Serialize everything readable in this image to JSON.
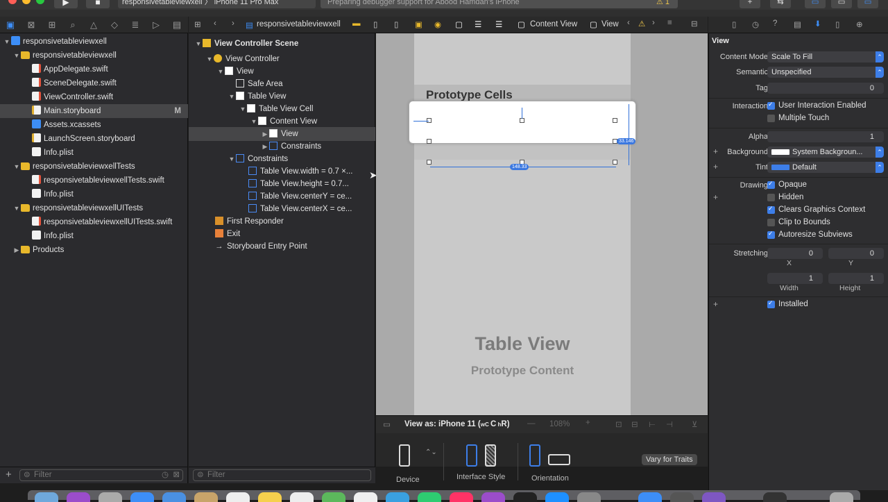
{
  "titlebar": {
    "scheme_project": "responsivetableviewxell",
    "scheme_device": "iPhone 11 Pro Max",
    "activity": "Preparing debugger support for Abood Hamdan's iPhone",
    "warning_count": "1"
  },
  "navigator": {
    "items": [
      {
        "label": "responsivetableviewxell",
        "icon": "project-icon"
      },
      {
        "label": "responsivetableviewxell",
        "icon": "folder-icon"
      },
      {
        "label": "AppDelegate.swift",
        "icon": "swift-file-icon"
      },
      {
        "label": "SceneDelegate.swift",
        "icon": "swift-file-icon"
      },
      {
        "label": "ViewController.swift",
        "icon": "swift-file-icon"
      },
      {
        "label": "Main.storyboard",
        "icon": "storyboard-icon",
        "badge": "M"
      },
      {
        "label": "Assets.xcassets",
        "icon": "asset-catalog-icon"
      },
      {
        "label": "LaunchScreen.storyboard",
        "icon": "storyboard-icon"
      },
      {
        "label": "Info.plist",
        "icon": "plist-icon"
      },
      {
        "label": "responsivetableviewxellTests",
        "icon": "folder-icon"
      },
      {
        "label": "responsivetableviewxellTests.swift",
        "icon": "swift-file-icon"
      },
      {
        "label": "Info.plist",
        "icon": "plist-icon"
      },
      {
        "label": "responsivetableviewxellUITests",
        "icon": "folder-icon"
      },
      {
        "label": "responsivetableviewxellUITests.swift",
        "icon": "swift-file-icon"
      },
      {
        "label": "Info.plist",
        "icon": "plist-icon"
      },
      {
        "label": "Products",
        "icon": "folder-icon"
      }
    ],
    "filter_placeholder": "Filter"
  },
  "jumpbar": {
    "project": "responsivetableviewxell",
    "content_view": "Content View",
    "view": "View"
  },
  "outline": {
    "items": [
      {
        "label": "View Controller Scene"
      },
      {
        "label": "View Controller"
      },
      {
        "label": "View"
      },
      {
        "label": "Safe Area"
      },
      {
        "label": "Table View"
      },
      {
        "label": "Table View Cell"
      },
      {
        "label": "Content View"
      },
      {
        "label": "View"
      },
      {
        "label": "Constraints"
      },
      {
        "label": "Constraints"
      },
      {
        "label": "Table View.width = 0.7 ×..."
      },
      {
        "label": "Table View.height = 0.7..."
      },
      {
        "label": "Table View.centerY = ce..."
      },
      {
        "label": "Table View.centerX = ce..."
      },
      {
        "label": "First Responder"
      },
      {
        "label": "Exit"
      },
      {
        "label": "Storyboard Entry Point"
      }
    ],
    "filter_placeholder": "Filter"
  },
  "canvas": {
    "prototype_cells": "Prototype Cells",
    "table_view_title": "Table View",
    "table_view_subtitle": "Prototype Content",
    "constraint_width": "148.33",
    "constraint_height": "33.146",
    "view_as": "View as: iPhone 11 (",
    "view_as_suffix": "C",
    "view_as_suffix2": "R)",
    "zoom": "108%",
    "device_label": "Device",
    "interface_style_label": "Interface Style",
    "orientation_label": "Orientation",
    "vary_for_traits": "Vary for Traits"
  },
  "inspector": {
    "section_title": "View",
    "content_mode_label": "Content Mode",
    "content_mode_value": "Scale To Fill",
    "semantic_label": "Semantic",
    "semantic_value": "Unspecified",
    "tag_label": "Tag",
    "tag_value": "0",
    "interaction_label": "Interaction",
    "user_interaction_enabled": "User Interaction Enabled",
    "multiple_touch": "Multiple Touch",
    "alpha_label": "Alpha",
    "alpha_value": "1",
    "background_label": "Background",
    "background_value": "System Backgroun...",
    "tint_label": "Tint",
    "tint_value": "Default",
    "drawing_label": "Drawing",
    "opaque": "Opaque",
    "hidden": "Hidden",
    "clears_graphics_context": "Clears Graphics Context",
    "clip_to_bounds": "Clip to Bounds",
    "autoresize_subviews": "Autoresize Subviews",
    "stretching_label": "Stretching",
    "stretch_x": "0",
    "stretch_y": "0",
    "x_label": "X",
    "y_label": "Y",
    "stretch_width": "1",
    "stretch_height": "1",
    "width_label": "Width",
    "height_label": "Height",
    "installed": "Installed",
    "tint_color": "#3d7ee8"
  }
}
